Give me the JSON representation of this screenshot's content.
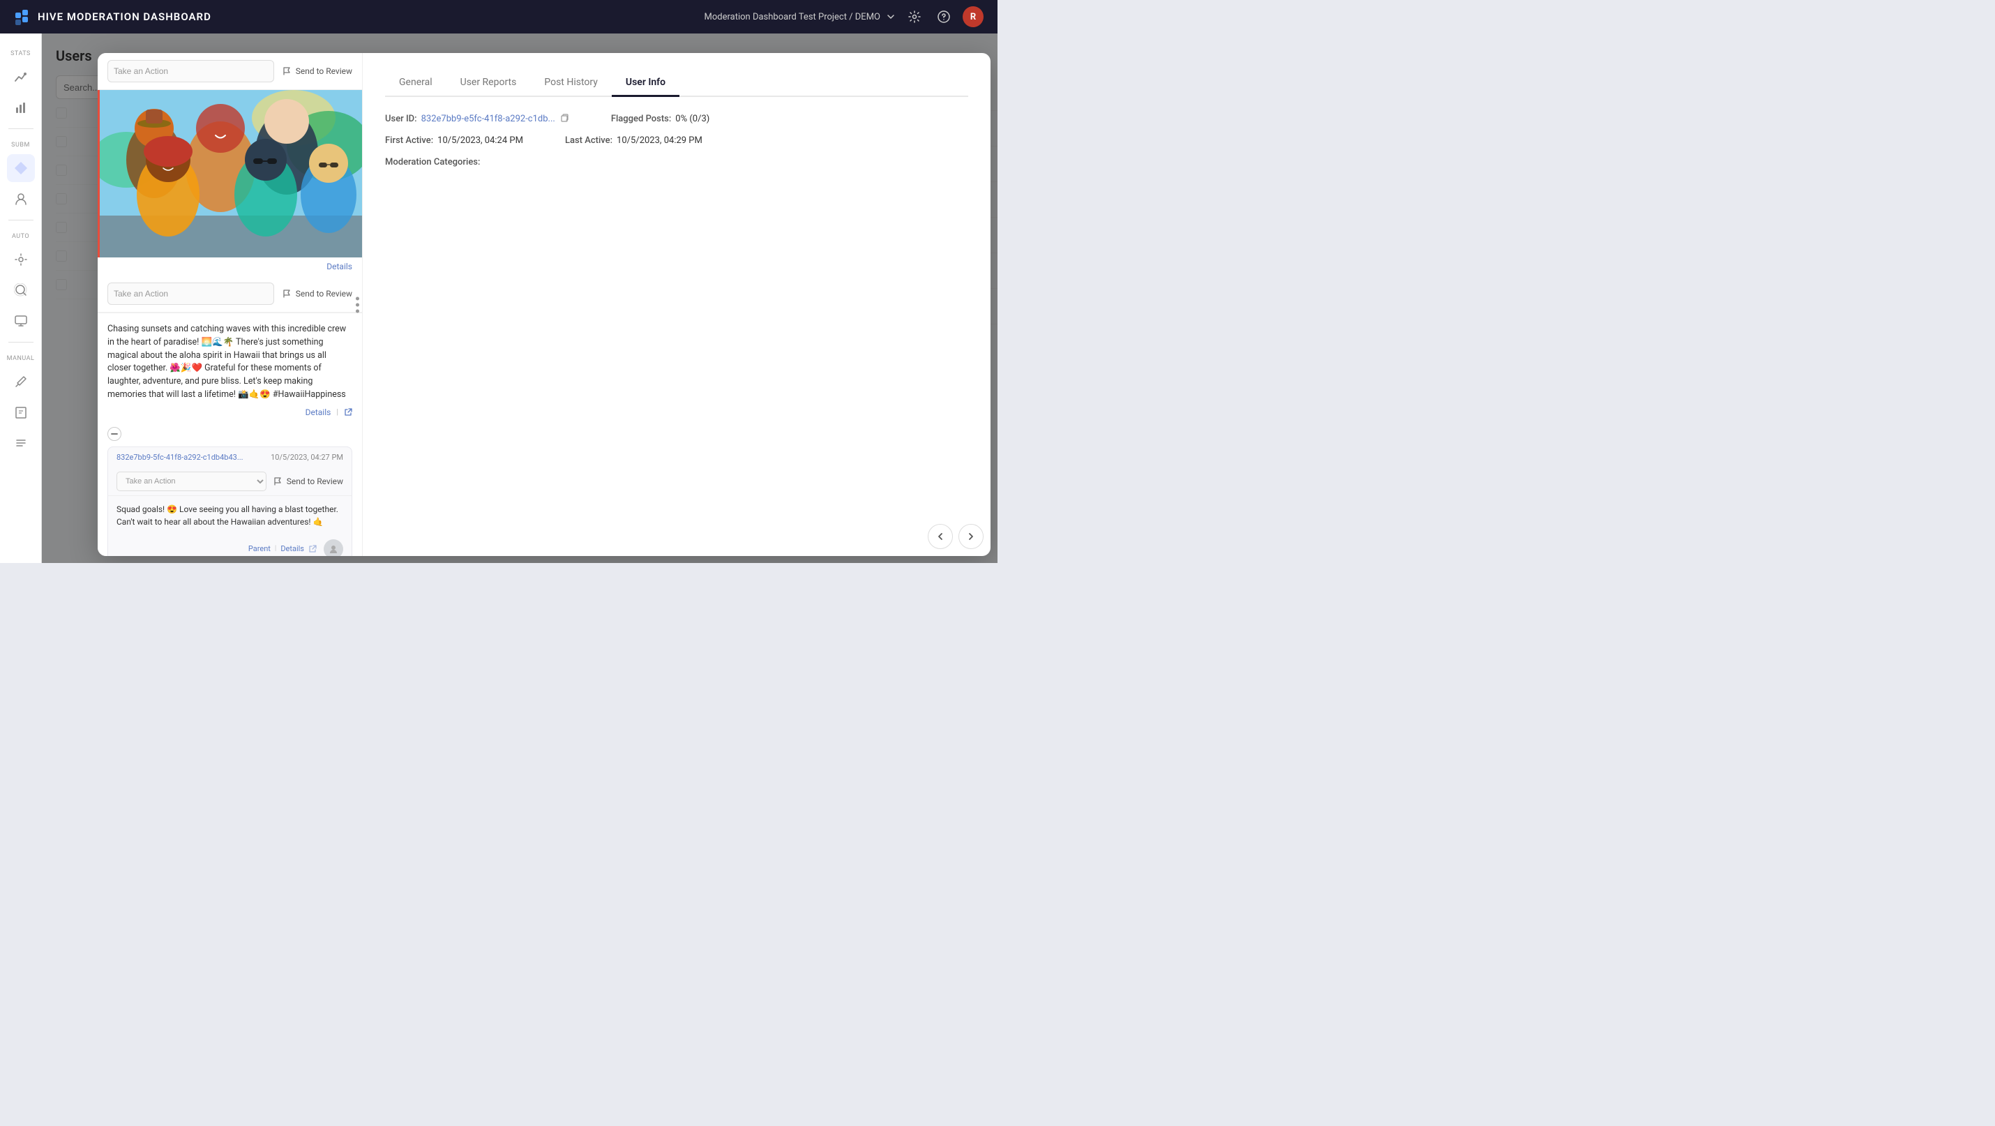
{
  "topNav": {
    "logoText": "HIVE MODERATION DASHBOARD",
    "projectName": "Moderation Dashboard Test Project / DEMO",
    "avatarInitial": "R"
  },
  "sidebar": {
    "sections": [
      {
        "label": "STATS",
        "items": [
          {
            "icon": "📊",
            "name": "stats-icon"
          },
          {
            "icon": "📈",
            "name": "trends-icon"
          }
        ]
      },
      {
        "label": "SUBM",
        "items": [
          {
            "icon": "🔷",
            "name": "diamond-icon"
          },
          {
            "icon": "👤",
            "name": "user-icon"
          }
        ]
      },
      {
        "label": "AUTO",
        "items": [
          {
            "icon": "⚙️",
            "name": "auto-icon"
          },
          {
            "icon": "🔍",
            "name": "search-circle-icon"
          },
          {
            "icon": "🖥️",
            "name": "monitor-icon"
          }
        ]
      },
      {
        "label": "MANUAL",
        "items": [
          {
            "icon": "🔧",
            "name": "tools-icon"
          },
          {
            "icon": "📖",
            "name": "book-icon"
          },
          {
            "icon": "📋",
            "name": "list-icon"
          }
        ]
      }
    ]
  },
  "modal": {
    "tabs": [
      {
        "label": "General",
        "id": "general"
      },
      {
        "label": "User Reports",
        "id": "user-reports"
      },
      {
        "label": "Post History",
        "id": "post-history"
      },
      {
        "label": "User Info",
        "id": "user-info"
      }
    ],
    "activeTab": "user-info",
    "userInfo": {
      "userId": {
        "label": "User ID:",
        "value": "832e7bb9-e5fc-41f8-a292-c1db..."
      },
      "flaggedPosts": {
        "label": "Flagged Posts:",
        "value": "0% (0/3)"
      },
      "firstActive": {
        "label": "First Active:",
        "value": "10/5/2023, 04:24 PM"
      },
      "lastActive": {
        "label": "Last Active:",
        "value": "10/5/2023, 04:29 PM"
      },
      "moderationCategories": {
        "label": "Moderation Categories:",
        "value": ""
      }
    }
  },
  "posts": {
    "imagePost": {
      "actionPlaceholder": "Take an Action",
      "sendToReview": "Send to Review",
      "details": "Details"
    },
    "textPost": {
      "actionPlaceholder": "Take an Action",
      "sendToReview": "Send to Review",
      "content": "Chasing sunsets and catching waves with this incredible crew in the heart of paradise! 🌅🌊🌴 There's just something magical about the aloha spirit in Hawaii that brings us all closer together. 🌺🎉❤️ Grateful for these moments of laughter, adventure, and pure bliss. Let's keep making memories that will last a lifetime! 📸🤙😍 #HawaiiHappiness",
      "details": "Details",
      "externalLink": "↗"
    },
    "comment": {
      "userId": "832e7bb9-5fc-41f8-a292-c1db4b43...",
      "timestamp": "10/5/2023, 04:27 PM",
      "actionPlaceholder": "Take an Action",
      "sendToReview": "Send to Review",
      "content": "Squad goals! 😍 Love seeing you all having a blast together. Can't wait to hear all about the Hawaiian adventures! 🤙",
      "parent": "Parent",
      "details": "Details"
    }
  },
  "ui": {
    "collapseBtn": "∧",
    "expandBtn": "⊕",
    "pipe": "|",
    "dots": "⋮",
    "prevArrow": "‹",
    "nextArrow": "›",
    "copyIcon": "⧉",
    "flagIcon": "⚑",
    "moreIcon": "···"
  }
}
